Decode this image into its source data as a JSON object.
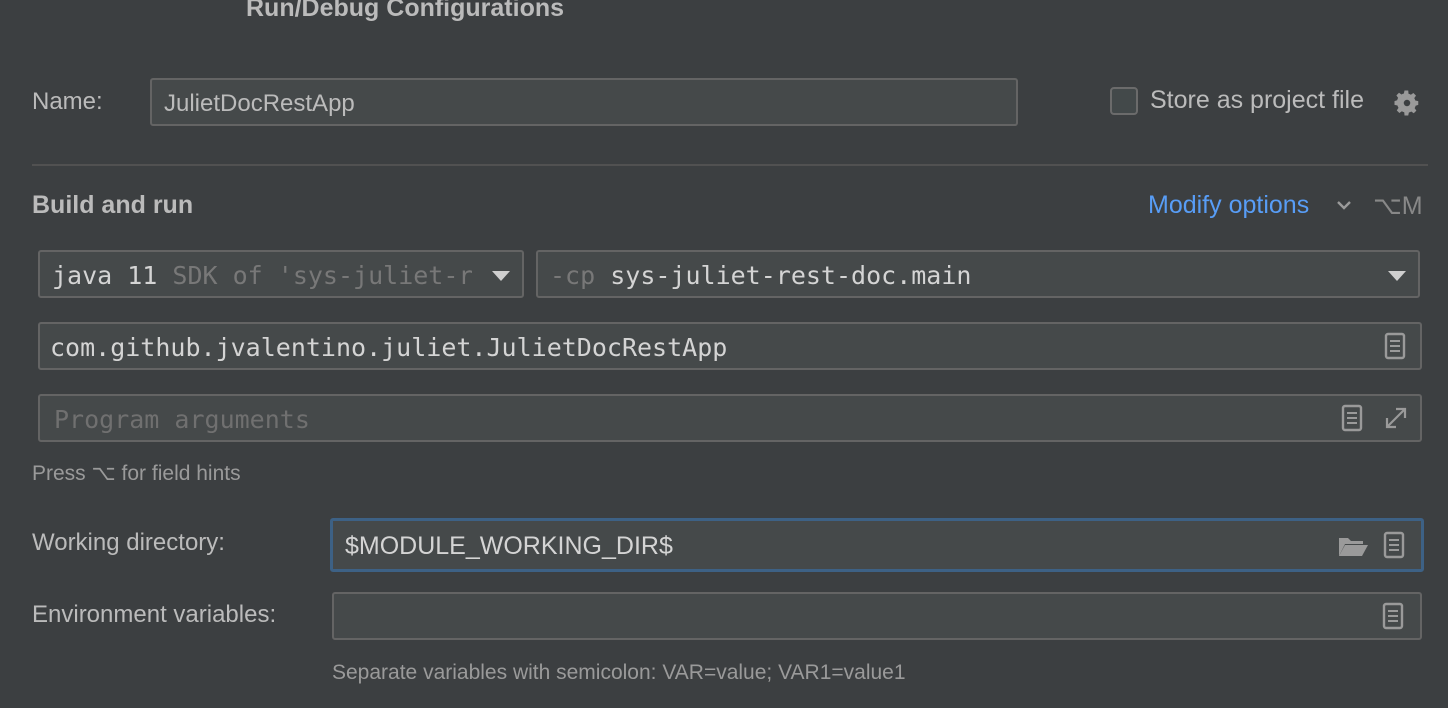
{
  "dialog": {
    "title": "Run/Debug Configurations"
  },
  "name_row": {
    "label": "Name:",
    "value": "JulietDocRestApp",
    "store_label": "Store as project file",
    "store_checked": false
  },
  "build_and_run": {
    "section_title": "Build and run",
    "modify_options": "Modify options",
    "modify_shortcut": "⌥M",
    "jdk": {
      "prefix": "java 11",
      "suffix": "SDK of 'sys-juliet-r"
    },
    "classpath": {
      "prefix": "-cp",
      "value": "sys-juliet-rest-doc.main"
    },
    "main_class": "com.github.jvalentino.juliet.JulietDocRestApp",
    "program_args_placeholder": "Program arguments",
    "field_hints": "Press ⌥ for field hints"
  },
  "working_directory": {
    "label": "Working directory:",
    "value": "$MODULE_WORKING_DIR$"
  },
  "environment": {
    "label": "Environment variables:",
    "value": "",
    "hint": "Separate variables with semicolon: VAR=value; VAR1=value1"
  },
  "colors": {
    "background": "#3c3f41",
    "field_background": "#45494a",
    "link": "#589df6",
    "focus_border": "#3d6185"
  },
  "icons": [
    "gear-icon",
    "chevron-down-icon",
    "dropdown-arrow-icon",
    "document-icon",
    "expand-icon",
    "folder-icon"
  ]
}
